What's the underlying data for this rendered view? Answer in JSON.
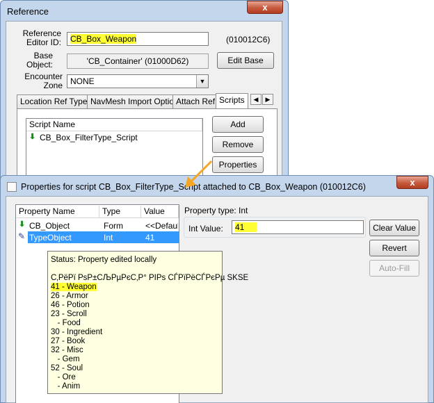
{
  "reference_window": {
    "title": "Reference",
    "close_label": "x",
    "editor_id_label": "Reference\nEditor ID:",
    "editor_id_value": "CB_Box_Weapon",
    "form_id": "(010012C6)",
    "base_object_label": "Base\nObject:",
    "base_object_value": "'CB_Container' (01000D62)",
    "edit_base_label": "Edit Base",
    "encounter_zone_label": "Encounter\nZone",
    "encounter_zone_value": "NONE",
    "tabs": [
      "Location Ref Type",
      "NavMesh Import Option",
      "Attach Ref",
      "Scripts"
    ],
    "scripts_header": "Script Name",
    "scripts": [
      "CB_Box_FilterType_Script"
    ],
    "add_label": "Add",
    "remove_label": "Remove",
    "properties_label": "Properties"
  },
  "properties_window": {
    "title": "Properties for script CB_Box_FilterType_Script attached to CB_Box_Weapon (010012C6)",
    "close_label": "x",
    "columns": [
      "Property Name",
      "Type",
      "Value"
    ],
    "rows": [
      {
        "name": "CB_Object",
        "type": "Form",
        "value": "<<Default"
      },
      {
        "name": "TypeObject",
        "type": "Int",
        "value": "41"
      }
    ],
    "property_type_label": "Property type: Int",
    "int_value_label": "Int Value:",
    "int_value": "41",
    "clear_value_label": "Clear Value",
    "revert_label": "Revert",
    "auto_fill_label": "Auto-Fill"
  },
  "tooltip": {
    "status": "Status: Property edited locally",
    "lines": [
      "С‚РёРї РѕР±СЉРµРєС‚Р° РІРѕ СЃРїРёСЃРєРµ SKSE",
      "41 - Weapon",
      "26 - Armor",
      "46 - Potion",
      "23 - Scroll",
      "   - Food",
      "30 - Ingredient",
      "27 - Book",
      "32 - Misc",
      "   - Gem",
      "52 - Soul",
      "   - Ore",
      "   - Anim"
    ]
  },
  "colors": {
    "highlight": "#ffff33",
    "selection": "#3399ff",
    "arrow": "#f5a623",
    "title_bar": "#c3d6ec"
  }
}
